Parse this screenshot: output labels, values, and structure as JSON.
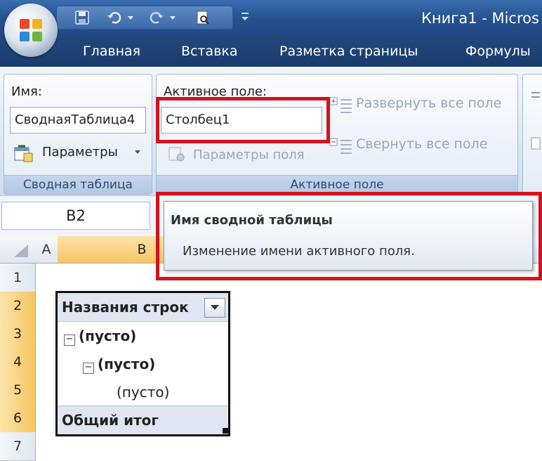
{
  "title_bar": {
    "document_title": "Книга1 - Micros"
  },
  "tabs": [
    "Главная",
    "Вставка",
    "Разметка страницы",
    "Формулы"
  ],
  "ribbon": {
    "pivot_group": {
      "name_label": "Имя:",
      "name_value": "СводнаяТаблица4",
      "options_label": "Параметры",
      "group_label": "Сводная таблица"
    },
    "active_field_group": {
      "field_label": "Активное поле:",
      "field_value": "Столбец1",
      "field_settings_label": "Параметры поля",
      "expand_label": "Развернуть все поле",
      "collapse_label": "Свернуть все поле",
      "group_label": "Активное поле"
    }
  },
  "tooltip": {
    "title": "Имя сводной таблицы",
    "text": "Изменение имени активного поля."
  },
  "name_box": "B2",
  "columns": [
    "A",
    "B"
  ],
  "rows": [
    "1",
    "2",
    "3",
    "4",
    "5",
    "6",
    "7"
  ],
  "pivot": {
    "header": "Названия строк",
    "items": [
      "(пусто)",
      "(пусто)",
      "(пусто)"
    ],
    "total": "Общий итог"
  },
  "colors": {
    "highlight": "#d4121b",
    "selected_header": "#f6c562",
    "ribbon_blue": "#24508e"
  }
}
